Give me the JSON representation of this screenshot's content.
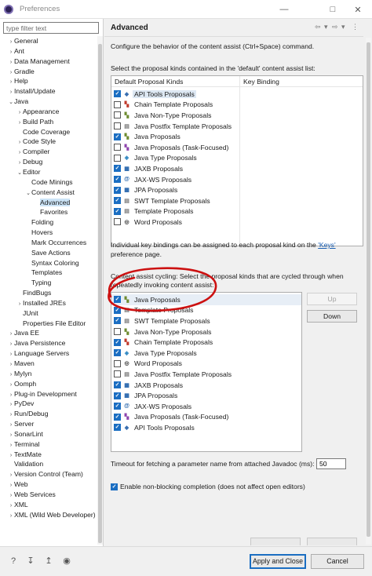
{
  "window": {
    "title": "Preferences"
  },
  "filter": {
    "placeholder": "type filter text"
  },
  "tree": [
    {
      "label": "General",
      "twisty": "›",
      "level": 0
    },
    {
      "label": "Ant",
      "twisty": "›",
      "level": 0
    },
    {
      "label": "Data Management",
      "twisty": "›",
      "level": 0
    },
    {
      "label": "Gradle",
      "twisty": "›",
      "level": 0
    },
    {
      "label": "Help",
      "twisty": "›",
      "level": 0
    },
    {
      "label": "Install/Update",
      "twisty": "›",
      "level": 0
    },
    {
      "label": "Java",
      "twisty": "⌄",
      "level": 0
    },
    {
      "label": "Appearance",
      "twisty": "›",
      "level": 1
    },
    {
      "label": "Build Path",
      "twisty": "›",
      "level": 1
    },
    {
      "label": "Code Coverage",
      "twisty": "",
      "level": 1
    },
    {
      "label": "Code Style",
      "twisty": "›",
      "level": 1
    },
    {
      "label": "Compiler",
      "twisty": "›",
      "level": 1
    },
    {
      "label": "Debug",
      "twisty": "›",
      "level": 1
    },
    {
      "label": "Editor",
      "twisty": "⌄",
      "level": 1
    },
    {
      "label": "Code Minings",
      "twisty": "",
      "level": 2
    },
    {
      "label": "Content Assist",
      "twisty": "⌄",
      "level": 2
    },
    {
      "label": "Advanced",
      "twisty": "",
      "level": 3,
      "selected": true
    },
    {
      "label": "Favorites",
      "twisty": "",
      "level": 3
    },
    {
      "label": "Folding",
      "twisty": "",
      "level": 2
    },
    {
      "label": "Hovers",
      "twisty": "",
      "level": 2
    },
    {
      "label": "Mark Occurrences",
      "twisty": "",
      "level": 2
    },
    {
      "label": "Save Actions",
      "twisty": "",
      "level": 2
    },
    {
      "label": "Syntax Coloring",
      "twisty": "",
      "level": 2
    },
    {
      "label": "Templates",
      "twisty": "",
      "level": 2
    },
    {
      "label": "Typing",
      "twisty": "",
      "level": 2
    },
    {
      "label": "FindBugs",
      "twisty": "",
      "level": 1
    },
    {
      "label": "Installed JREs",
      "twisty": "›",
      "level": 1
    },
    {
      "label": "JUnit",
      "twisty": "",
      "level": 1
    },
    {
      "label": "Properties File Editor",
      "twisty": "",
      "level": 1
    },
    {
      "label": "Java EE",
      "twisty": "›",
      "level": 0
    },
    {
      "label": "Java Persistence",
      "twisty": "›",
      "level": 0
    },
    {
      "label": "Language Servers",
      "twisty": "›",
      "level": 0
    },
    {
      "label": "Maven",
      "twisty": "›",
      "level": 0
    },
    {
      "label": "Mylyn",
      "twisty": "›",
      "level": 0
    },
    {
      "label": "Oomph",
      "twisty": "›",
      "level": 0
    },
    {
      "label": "Plug-in Development",
      "twisty": "›",
      "level": 0
    },
    {
      "label": "PyDev",
      "twisty": "›",
      "level": 0
    },
    {
      "label": "Run/Debug",
      "twisty": "›",
      "level": 0
    },
    {
      "label": "Server",
      "twisty": "›",
      "level": 0
    },
    {
      "label": "SonarLint",
      "twisty": "›",
      "level": 0
    },
    {
      "label": "Terminal",
      "twisty": "›",
      "level": 0
    },
    {
      "label": "TextMate",
      "twisty": "›",
      "level": 0
    },
    {
      "label": "Validation",
      "twisty": "",
      "level": 0
    },
    {
      "label": "Version Control (Team)",
      "twisty": "›",
      "level": 0
    },
    {
      "label": "Web",
      "twisty": "›",
      "level": 0
    },
    {
      "label": "Web Services",
      "twisty": "›",
      "level": 0
    },
    {
      "label": "XML",
      "twisty": "›",
      "level": 0
    },
    {
      "label": "XML (Wild Web Developer)",
      "twisty": "›",
      "level": 0
    }
  ],
  "page": {
    "title": "Advanced",
    "intro": "Configure the behavior of the content assist (Ctrl+Space) command.",
    "default_list_label": "Select the proposal kinds contained in the 'default' content assist list:",
    "col_kinds": "Default Proposal Kinds",
    "col_binding": "Key Binding",
    "keys_text_before": "Individual key bindings can be assigned to each proposal kind on the ",
    "keys_link": "'Keys'",
    "keys_text_after": "preference page.",
    "cycling_label_1": "Content assist cycling: Select the proposal kinds that are cycled through when",
    "cycling_label_2": "repeatedly invoking content assist:",
    "up_label": "Up",
    "down_label": "Down",
    "timeout_label": "Timeout for fetching a parameter name from attached Javadoc (ms):",
    "timeout_value": "50",
    "nonblocking_label": "Enable non-blocking completion (does not affect open editors)"
  },
  "default_kinds": [
    {
      "label": "API Tools Proposals",
      "checked": true,
      "icon": "api-tools-icon",
      "glyph": "◆",
      "color": "#3a6fb0"
    },
    {
      "label": "Chain Template Proposals",
      "checked": false,
      "icon": "chain-template-icon",
      "glyph": "▚",
      "color": "#c0392b"
    },
    {
      "label": "Java Non-Type Proposals",
      "checked": false,
      "icon": "java-proposal-icon",
      "glyph": "▚",
      "color": "#6d8b2f"
    },
    {
      "label": "Java Postfix Template Proposals",
      "checked": false,
      "icon": "template-icon",
      "glyph": "▤",
      "color": "#777777"
    },
    {
      "label": "Java Proposals",
      "checked": true,
      "icon": "java-proposal-icon",
      "glyph": "▚",
      "color": "#6d8b2f"
    },
    {
      "label": "Java Proposals (Task-Focused)",
      "checked": false,
      "icon": "task-focused-icon",
      "glyph": "▚",
      "color": "#8e44ad"
    },
    {
      "label": "Java Type Proposals",
      "checked": false,
      "icon": "java-type-icon",
      "glyph": "◈",
      "color": "#2e86c1"
    },
    {
      "label": "JAXB Proposals",
      "checked": true,
      "icon": "jaxb-icon",
      "glyph": "▦",
      "color": "#1f5fa8"
    },
    {
      "label": "JAX-WS Proposals",
      "checked": true,
      "icon": "jax-ws-icon",
      "glyph": "@",
      "color": "#1f5fa8"
    },
    {
      "label": "JPA Proposals",
      "checked": true,
      "icon": "jpa-icon",
      "glyph": "▦",
      "color": "#1f5fa8"
    },
    {
      "label": "SWT Template Proposals",
      "checked": true,
      "icon": "swt-template-icon",
      "glyph": "▤",
      "color": "#777777"
    },
    {
      "label": "Template Proposals",
      "checked": true,
      "icon": "template-icon",
      "glyph": "▤",
      "color": "#777777"
    },
    {
      "label": "Word Proposals",
      "checked": false,
      "icon": "word-proposal-icon",
      "glyph": "◎",
      "color": "#333333"
    }
  ],
  "cycling_kinds": [
    {
      "label": "Java Proposals",
      "checked": true,
      "icon": "java-proposal-icon",
      "glyph": "▚",
      "color": "#6d8b2f"
    },
    {
      "label": "Template Proposals",
      "checked": true,
      "icon": "template-icon",
      "glyph": "▤",
      "color": "#777777"
    },
    {
      "label": "SWT Template Proposals",
      "checked": true,
      "icon": "swt-template-icon",
      "glyph": "▤",
      "color": "#777777"
    },
    {
      "label": "Java Non-Type Proposals",
      "checked": false,
      "icon": "java-proposal-icon",
      "glyph": "▚",
      "color": "#6d8b2f"
    },
    {
      "label": "Chain Template Proposals",
      "checked": true,
      "icon": "chain-template-icon",
      "glyph": "▚",
      "color": "#c0392b"
    },
    {
      "label": "Java Type Proposals",
      "checked": true,
      "icon": "java-type-icon",
      "glyph": "◈",
      "color": "#2e86c1"
    },
    {
      "label": "Word Proposals",
      "checked": false,
      "icon": "word-proposal-icon",
      "glyph": "◎",
      "color": "#333333"
    },
    {
      "label": "Java Postfix Template Proposals",
      "checked": false,
      "icon": "template-icon",
      "glyph": "▤",
      "color": "#777777"
    },
    {
      "label": "JAXB Proposals",
      "checked": true,
      "icon": "jaxb-icon",
      "glyph": "▦",
      "color": "#1f5fa8"
    },
    {
      "label": "JPA Proposals",
      "checked": true,
      "icon": "jpa-icon",
      "glyph": "▦",
      "color": "#1f5fa8"
    },
    {
      "label": "JAX-WS Proposals",
      "checked": true,
      "icon": "jax-ws-icon",
      "glyph": "@",
      "color": "#1f5fa8"
    },
    {
      "label": "Java Proposals (Task-Focused)",
      "checked": true,
      "icon": "task-focused-icon",
      "glyph": "▚",
      "color": "#8e44ad"
    },
    {
      "label": "API Tools Proposals",
      "checked": true,
      "icon": "api-tools-icon",
      "glyph": "◆",
      "color": "#3a6fb0"
    }
  ],
  "buttons": {
    "apply_close": "Apply and Close",
    "cancel": "Cancel"
  },
  "colors": {
    "annotation": "#cc1111",
    "accent": "#1b6ec2",
    "selection": "#cce4f7"
  }
}
